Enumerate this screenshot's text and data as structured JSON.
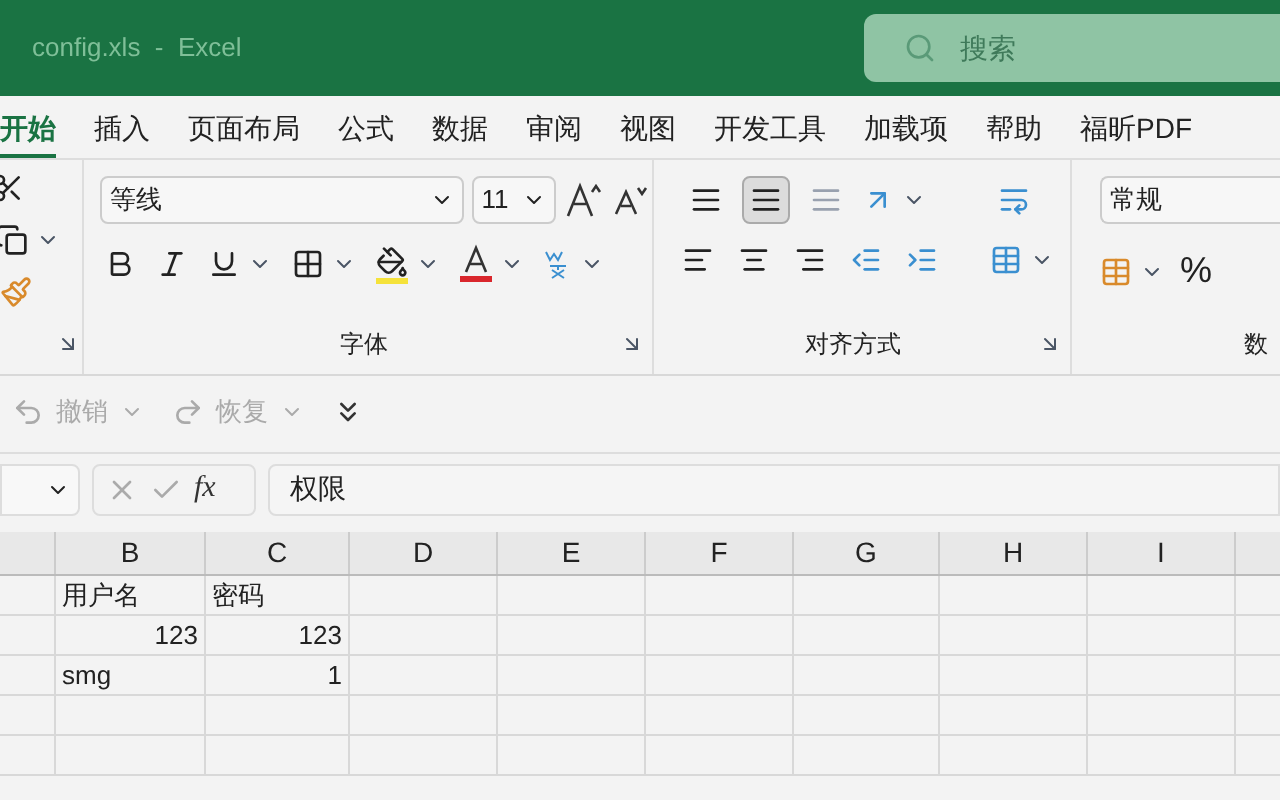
{
  "window": {
    "title": "config.xls  -  Excel"
  },
  "search": {
    "placeholder": "搜索"
  },
  "tabs": [
    {
      "label": "开始",
      "selected": true
    },
    {
      "label": "插入",
      "selected": false
    },
    {
      "label": "页面布局",
      "selected": false
    },
    {
      "label": "公式",
      "selected": false
    },
    {
      "label": "数据",
      "selected": false
    },
    {
      "label": "审阅",
      "selected": false
    },
    {
      "label": "视图",
      "selected": false
    },
    {
      "label": "开发工具",
      "selected": false
    },
    {
      "label": "加载项",
      "selected": false
    },
    {
      "label": "帮助",
      "selected": false
    },
    {
      "label": "福昕PDF",
      "selected": false
    }
  ],
  "ribbon": {
    "font_name": "等线",
    "font_size": "11",
    "font_group": "字体",
    "align_group": "对齐方式",
    "number_format": "常规",
    "number_group": "数",
    "percent": "%",
    "valign_buttons": [
      {
        "selected": false
      },
      {
        "selected": true
      },
      {
        "selected": false
      }
    ]
  },
  "quick_access": {
    "undo": "撤销",
    "redo": "恢复"
  },
  "formula_bar": {
    "fx": "fx",
    "value": "权限"
  },
  "columns": [
    "B",
    "C",
    "D",
    "E",
    "F",
    "G",
    "H",
    "I"
  ],
  "rows": [
    {
      "cells": [
        {
          "text": "用户名",
          "kind": "text"
        },
        {
          "text": "密码",
          "kind": "text"
        }
      ]
    },
    {
      "cells": [
        {
          "text": "123",
          "kind": "number"
        },
        {
          "text": "123",
          "kind": "number"
        }
      ]
    },
    {
      "cells": [
        {
          "text": "smg",
          "kind": "text"
        },
        {
          "text": "1",
          "kind": "number"
        }
      ]
    },
    {
      "cells": []
    },
    {
      "cells": []
    }
  ]
}
